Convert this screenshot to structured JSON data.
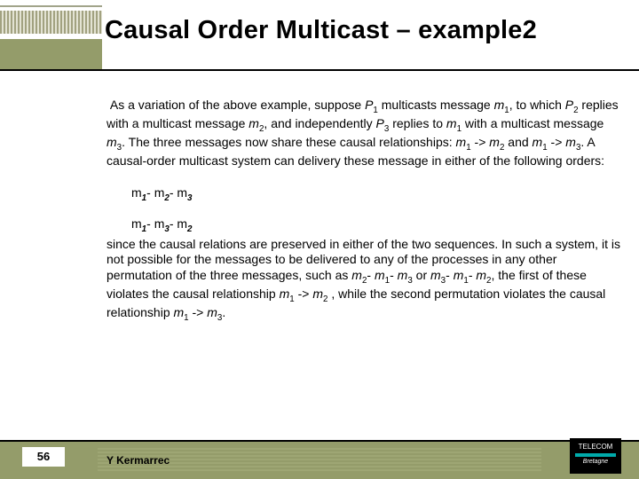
{
  "header": {
    "title": "Causal Order Multicast – example2"
  },
  "body": {
    "para1_a": "As a variation of the above example, suppose ",
    "para1_P1": "P",
    "para1_P1sub": "1",
    "para1_b": " multicasts message ",
    "para1_m1": "m",
    "para1_m1sub": "1",
    "para1_c": ", to which ",
    "para1_P2": "P",
    "para1_P2sub": "2",
    "para1_d": " replies with a multicast message ",
    "para1_m2": "m",
    "para1_m2sub": "2",
    "para1_e": ", and independently ",
    "para1_P3": "P",
    "para1_P3sub": "3",
    "para1_f": " replies to ",
    "para1_m1b": "m",
    "para1_m1bsub": "1",
    "para1_g": " with a multicast message ",
    "para1_m3": "m",
    "para1_m3sub": "3",
    "para1_h": ". The three messages now share these causal relationships: ",
    "para1_r1a": "m",
    "para1_r1asub": "1",
    "para1_arrow1": " -> ",
    "para1_r1b": "m",
    "para1_r1bsub": "2",
    "para1_and": " and ",
    "para1_r2a": "m",
    "para1_r2asub": "1",
    "para1_arrow2": " -> ",
    "para1_r2b": "m",
    "para1_r2bsub": "3",
    "para1_i": ". A causal-order multicast system can delivery these message in either of the following orders:",
    "order1_a": "m",
    "order1_asub": "1",
    "order1_sep1": "- ",
    "order1_b": "m",
    "order1_bsub": "2",
    "order1_sep2": "- ",
    "order1_c": "m",
    "order1_csub": "3",
    "order2_a": "m",
    "order2_asub": "1",
    "order2_sep1": "- ",
    "order2_b": "m",
    "order2_bsub": "3",
    "order2_sep2": "- ",
    "order2_c": "m",
    "order2_csub": "2",
    "para2_a": "since the causal relations are preserved in either of the two sequences. In such a system, it is not possible for the messages to be delivered to any of the processes in any other permutation of the three messages, such as ",
    "perm1_a": "m",
    "perm1_asub": "2",
    "perm1_s1": "- ",
    "perm1_b": "m",
    "perm1_bsub": "1",
    "perm1_s2": "- ",
    "perm1_c": "m",
    "perm1_csub": "3",
    "para2_or": " or ",
    "perm2_a": "m",
    "perm2_asub": "3",
    "perm2_s1": "- ",
    "perm2_b": "m",
    "perm2_bsub": "1",
    "perm2_s2": "- ",
    "perm2_c": "m",
    "perm2_csub": "2",
    "para2_b": ", the first of these violates the causal relationship ",
    "rel1_a": "m",
    "rel1_asub": "1",
    "rel1_arrow": " -> ",
    "rel1_b": "m",
    "rel1_bsub": "2",
    "para2_c": " , while the second permutation violates the causal relationship ",
    "rel2_a": "m",
    "rel2_asub": "1",
    "rel2_arrow": " -> ",
    "rel2_b": "m",
    "rel2_bsub": "3",
    "para2_d": "."
  },
  "footer": {
    "page": "56",
    "author": "Y Kermarrec",
    "logo_top": "TELECOM",
    "logo_bottom": "Bretagne"
  }
}
